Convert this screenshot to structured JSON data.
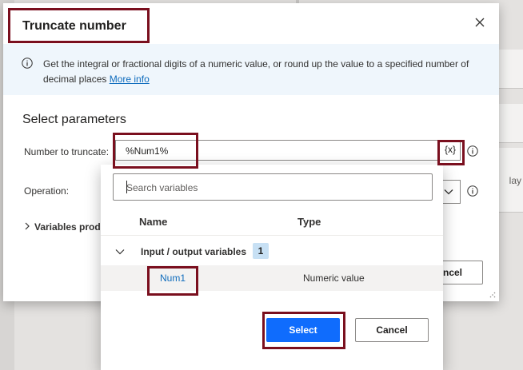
{
  "dialog": {
    "title": "Truncate number",
    "info_text": "Get the integral or fractional digits of a numeric value, or round up the value to a specified number of decimal places",
    "info_link": "More info",
    "section_title": "Select parameters",
    "fields": {
      "number_label": "Number to truncate:",
      "number_value": "%Num1%",
      "var_button": "{x}",
      "operation_label": "Operation:",
      "variables_produced_label": "Variables produced"
    },
    "partial_cancel": "ncel"
  },
  "background": {
    "card_text": "lay"
  },
  "picker": {
    "search_placeholder": "Search variables",
    "col_name": "Name",
    "col_type": "Type",
    "group": {
      "label": "Input / output variables",
      "count": "1"
    },
    "variables": [
      {
        "name": "Num1",
        "type": "Numeric value"
      }
    ],
    "select_button": "Select",
    "cancel_button": "Cancel"
  },
  "colors": {
    "accent": "#0f6cfd",
    "link": "#0f6cbd",
    "highlight": "#7a0f1e",
    "info_bg": "#eff6fc"
  },
  "icons": {
    "close": "close-icon",
    "info": "info-icon",
    "chevron_right": "chevron-right-icon",
    "chevron_down": "chevron-down-icon"
  }
}
